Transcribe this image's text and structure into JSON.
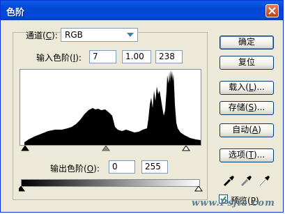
{
  "window": {
    "title": "色阶"
  },
  "channel": {
    "label": "通道",
    "shortcut": "C",
    "value": "RGB"
  },
  "input_levels": {
    "label": "输入色阶",
    "shortcut": "I",
    "black": "7",
    "gamma": "1.00",
    "white": "238"
  },
  "output_levels": {
    "label": "输出色阶",
    "shortcut": "O",
    "black": "0",
    "white": "255"
  },
  "buttons": {
    "ok": "确定",
    "reset": "复位",
    "load": {
      "text": "载入",
      "shortcut": "L",
      "suffix": "..."
    },
    "save": {
      "text": "存储",
      "shortcut": "S",
      "suffix": "..."
    },
    "auto": {
      "text": "自动",
      "shortcut": "A"
    },
    "options": {
      "text": "选项",
      "shortcut": "T",
      "suffix": "..."
    }
  },
  "preview": {
    "label": "预览",
    "shortcut": "P",
    "checked": true
  },
  "watermark": "www.Psjia.com",
  "colors": {
    "titlebar": "#0a5de9",
    "dialog_bg": "#ece9d8",
    "accent": "#3c7fb1"
  },
  "icons": [
    "close-icon",
    "dropdown-arrow-icon",
    "black-eyedropper-icon",
    "gray-eyedropper-icon",
    "white-eyedropper-icon"
  ]
}
